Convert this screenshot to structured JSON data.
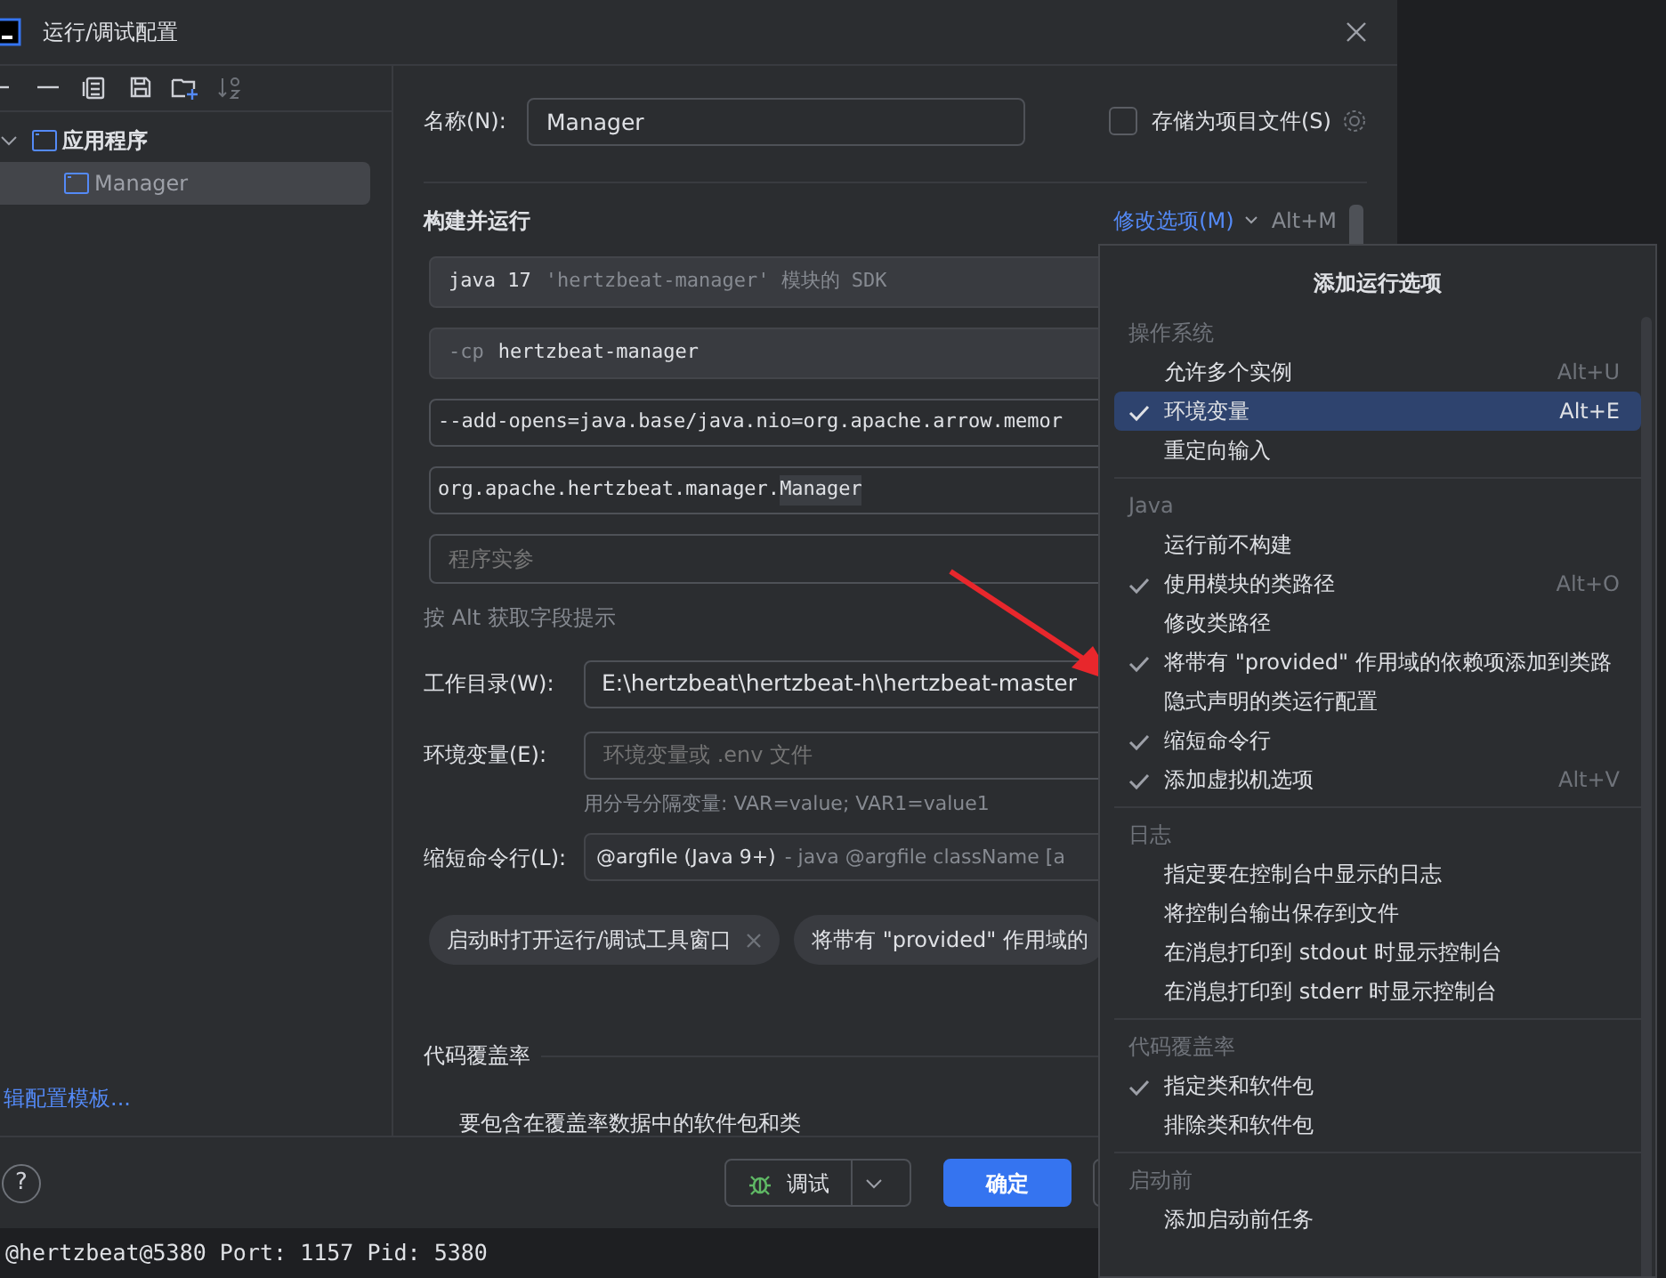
{
  "window": {
    "title": "运行/调试配置"
  },
  "tree": [
    {
      "label": "应用程序",
      "expanded": true,
      "children": [
        {
          "label": "Manager",
          "selected": true
        }
      ]
    }
  ],
  "edit_templates_link": "辑配置模板...",
  "form": {
    "name_label": "名称(N):",
    "name_value": "Manager",
    "store_option": {
      "label": "存储为项目文件(S)",
      "checked": false
    },
    "section_title": "构建并运行",
    "modify_options": {
      "label": "修改选项(M)",
      "shortcut": "Alt+M"
    },
    "sdk": {
      "value": "java 17",
      "hint": "'hertzbeat-manager' 模块的 SDK"
    },
    "classpath": {
      "prefix": "-cp",
      "value": "hertzbeat-manager"
    },
    "vm_options": {
      "value": "--add-opens=java.base/java.nio=org.apache.arrow.memor"
    },
    "main_class": {
      "value": "org.apache.hertzbeat.manager.",
      "highlighted": "Manager"
    },
    "program_args": {
      "placeholder": "程序实参"
    },
    "field_hint": "按 Alt 获取字段提示",
    "working_dir": {
      "label": "工作目录(W):",
      "value": "E:\\hertzbeat\\hertzbeat-h\\hertzbeat-master"
    },
    "env_vars": {
      "label": "环境变量(E):",
      "placeholder": "环境变量或 .env 文件",
      "hint": "用分号分隔变量: VAR=value; VAR1=value1"
    },
    "shorten": {
      "label": "缩短命令行(L):",
      "value": "@argfile (Java 9+)",
      "detail": "- java @argfile className [a"
    },
    "chips": [
      {
        "label": "启动时打开运行/调试工具窗口",
        "closable": true
      },
      {
        "label": "将带有 \"provided\" 作用域的",
        "closable": false
      }
    ],
    "coverage": {
      "title": "代码覆盖率",
      "item": "要包含在覆盖率数据中的软件包和类"
    }
  },
  "footer": {
    "help": "?",
    "debug_button": "调试",
    "ok_button": "确定"
  },
  "console": "@hertzbeat@5380 Port: 1157 Pid: 5380",
  "popup": {
    "title": "添加运行选项",
    "groups": [
      {
        "title": "操作系统",
        "items": [
          {
            "label": "允许多个实例",
            "checked": false,
            "selected": false,
            "shortcut": "Alt+U"
          },
          {
            "label": "环境变量",
            "checked": true,
            "selected": true,
            "shortcut": "Alt+E"
          },
          {
            "label": "重定向输入",
            "checked": false,
            "selected": false
          }
        ]
      },
      {
        "title": "Java",
        "items": [
          {
            "label": "运行前不构建",
            "checked": false,
            "selected": false
          },
          {
            "label": "使用模块的类路径",
            "checked": true,
            "selected": false,
            "shortcut": "Alt+O"
          },
          {
            "label": "修改类路径",
            "checked": false,
            "selected": false
          },
          {
            "label": "将带有 \"provided\" 作用域的依赖项添加到类路",
            "checked": true,
            "selected": false
          },
          {
            "label": "隐式声明的类运行配置",
            "checked": false,
            "selected": false
          },
          {
            "label": "缩短命令行",
            "checked": true,
            "selected": false
          },
          {
            "label": "添加虚拟机选项",
            "checked": true,
            "selected": false,
            "shortcut": "Alt+V"
          }
        ]
      },
      {
        "title": "日志",
        "items": [
          {
            "label": "指定要在控制台中显示的日志",
            "checked": false,
            "selected": false
          },
          {
            "label": "将控制台输出保存到文件",
            "checked": false,
            "selected": false
          },
          {
            "label": "在消息打印到 stdout 时显示控制台",
            "checked": false,
            "selected": false
          },
          {
            "label": "在消息打印到 stderr 时显示控制台",
            "checked": false,
            "selected": false
          }
        ]
      },
      {
        "title": "代码覆盖率",
        "items": [
          {
            "label": "指定类和软件包",
            "checked": true,
            "selected": false
          },
          {
            "label": "排除类和软件包",
            "checked": false,
            "selected": false
          }
        ]
      },
      {
        "title": "启动前",
        "items": [
          {
            "label": "添加启动前任务",
            "checked": false,
            "selected": false
          }
        ]
      }
    ]
  }
}
